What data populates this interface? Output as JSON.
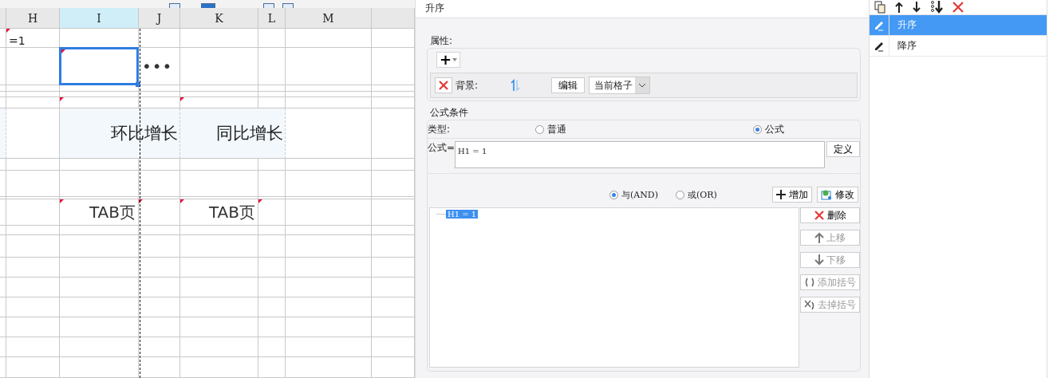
{
  "sheet": {
    "columns": [
      {
        "label": "H",
        "selected": false
      },
      {
        "label": "I",
        "selected": true
      },
      {
        "label": "J",
        "selected": false
      },
      {
        "label": "K",
        "selected": false
      },
      {
        "label": "L",
        "selected": false
      },
      {
        "label": "M",
        "selected": false
      }
    ],
    "formula_cell": "=1",
    "more_glyph": "•••",
    "headers": [
      "环比增长",
      "同比增长"
    ],
    "tabs": [
      "TAB页",
      "TAB页"
    ]
  },
  "dialog": {
    "title": "升序",
    "attributes": {
      "legend": "属性:",
      "add_glyph": "+",
      "background_label": "背景:",
      "edit_button": "编辑",
      "scope": "当前格子"
    },
    "condition": {
      "legend": "公式条件",
      "type_label": "类型:",
      "types": [
        {
          "label": "普通",
          "selected": false
        },
        {
          "label": "公式",
          "selected": true
        }
      ],
      "formula_label": "公式=",
      "formula": "H1 = 1",
      "define_button": "定义",
      "logic": [
        {
          "label": "与(AND)",
          "selected": true
        },
        {
          "label": "或(OR)",
          "selected": false
        }
      ],
      "add_button": "增加",
      "modify_button": "修改",
      "conditions": [
        {
          "text": "H1 = 1",
          "selected": true
        }
      ],
      "actions": [
        {
          "kind": "delete",
          "label": "删除",
          "disabled": false
        },
        {
          "kind": "up",
          "label": "上移",
          "disabled": true
        },
        {
          "kind": "down",
          "label": "下移",
          "disabled": true
        },
        {
          "kind": "add-paren",
          "label": "添加括号",
          "disabled": true
        },
        {
          "kind": "remove-paren",
          "label": "去掉括号",
          "disabled": true
        }
      ]
    }
  },
  "rules": {
    "items": [
      {
        "label": "升序",
        "selected": true
      },
      {
        "label": "降序",
        "selected": false
      }
    ]
  }
}
